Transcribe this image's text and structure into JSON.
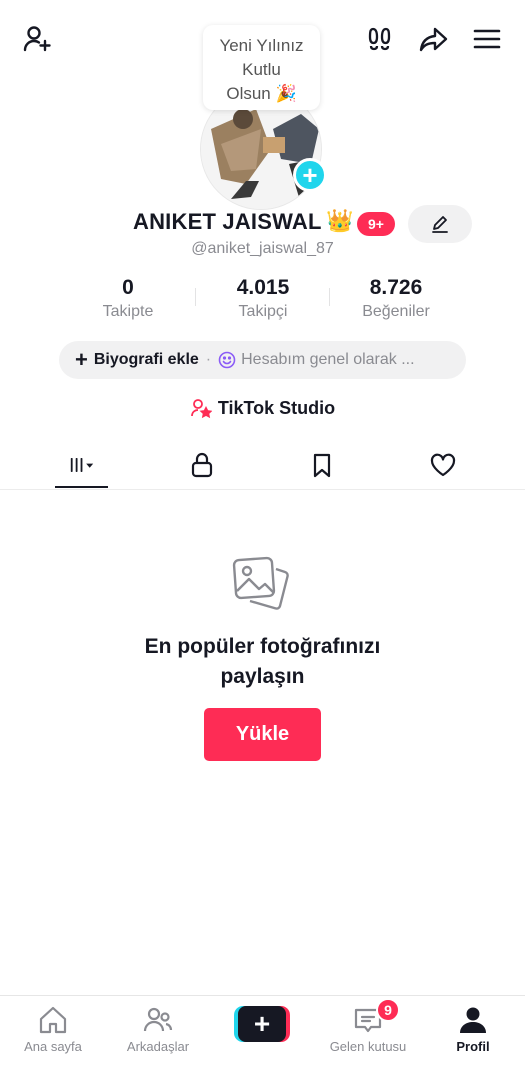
{
  "header": {
    "greeting_line1": "Yeni Yılınız",
    "greeting_line2": "Kutlu",
    "greeting_line3": "Olsun 🎉"
  },
  "profile": {
    "display_name": "ANIKET JAISWAL",
    "crown": "👑",
    "badge": "9+",
    "username": "@aniket_jaiswal_87"
  },
  "stats": [
    {
      "value": "0",
      "label": "Takipte"
    },
    {
      "value": "4.015",
      "label": "Takipçi"
    },
    {
      "value": "8.726",
      "label": "Beğeniler"
    }
  ],
  "bio": {
    "add_label": "Biyografi ekle",
    "separator": "·",
    "status_text": "Hesabım genel olarak ..."
  },
  "studio": {
    "label": "TikTok Studio"
  },
  "empty_state": {
    "title_line1": "En popüler fotoğrafınızı",
    "title_line2": "paylaşın",
    "upload_label": "Yükle"
  },
  "bottom_nav": {
    "home": "Ana sayfa",
    "friends": "Arkadaşlar",
    "create": "+",
    "inbox": "Gelen kutusu",
    "inbox_badge": "9",
    "profile": "Profil"
  },
  "colors": {
    "accent": "#fe2c55",
    "cyan": "#20d5ec",
    "text": "#161823",
    "muted": "#8a8b91"
  }
}
